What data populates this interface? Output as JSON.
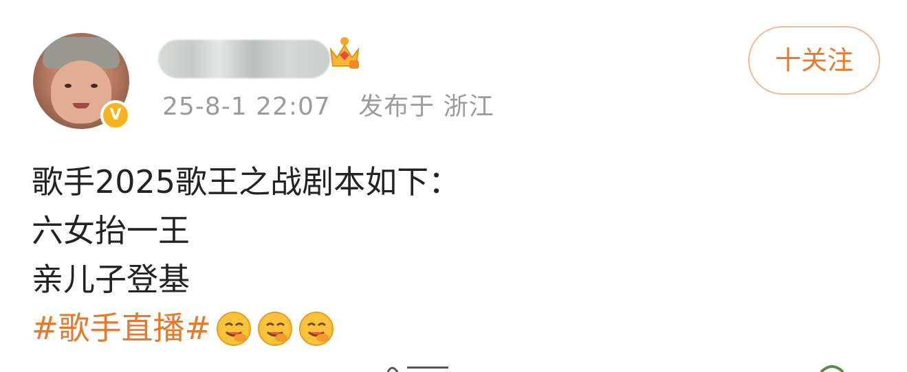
{
  "post": {
    "meta": {
      "timestamp": "25-8-1 22:07",
      "location": "发布于 浙江"
    },
    "follow_label": "十关注",
    "verified_badge": "V",
    "content_lines": [
      "歌手2025歌王之战剧本如下：",
      "六女抬一王",
      "亲儿子登基"
    ],
    "hashtag": "#歌手直播#",
    "emojis": [
      "yummy-face-icon",
      "yummy-face-icon",
      "yummy-face-icon"
    ]
  },
  "colors": {
    "accent": "#e8782a",
    "meta_text": "#9b9b9b",
    "follow_border": "#f3b98f",
    "verified": "#f6b51e"
  }
}
